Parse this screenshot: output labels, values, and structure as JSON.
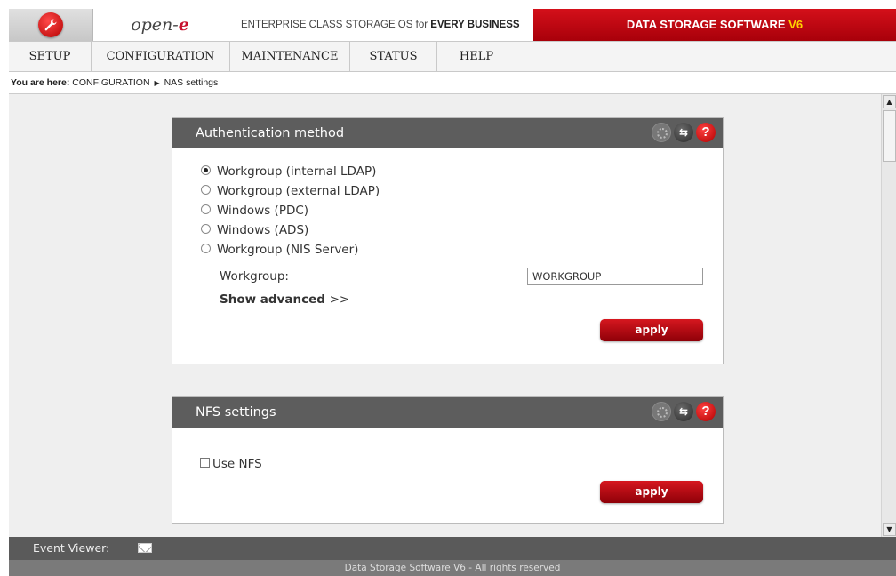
{
  "header": {
    "brand_prefix": "open-",
    "brand_suffix": "e",
    "tagline_plain": "ENTERPRISE CLASS STORAGE OS for ",
    "tagline_bold": "EVERY BUSINESS",
    "product_main": "DATA STORAGE SOFTWARE ",
    "product_version": "V6",
    "logo_icon": "wrench-icon"
  },
  "menu": {
    "items": [
      {
        "label": "SETUP"
      },
      {
        "label": "CONFIGURATION"
      },
      {
        "label": "MAINTENANCE"
      },
      {
        "label": "STATUS"
      },
      {
        "label": "HELP"
      }
    ]
  },
  "breadcrumb": {
    "prefix": "You are here:",
    "path": [
      "CONFIGURATION",
      "NAS settings"
    ]
  },
  "auth_panel": {
    "title": "Authentication method",
    "options": [
      {
        "label": "Workgroup (internal LDAP)",
        "selected": true
      },
      {
        "label": "Workgroup (external LDAP)",
        "selected": false
      },
      {
        "label": "Windows (PDC)",
        "selected": false
      },
      {
        "label": "Windows (ADS)",
        "selected": false
      },
      {
        "label": "Workgroup (NIS Server)",
        "selected": false
      }
    ],
    "workgroup_label": "Workgroup:",
    "workgroup_value": "WORKGROUP",
    "show_advanced": "Show advanced",
    "show_advanced_arrows": ">>",
    "apply_label": "apply"
  },
  "nfs_panel": {
    "title": "NFS settings",
    "use_nfs_label": "Use NFS",
    "use_nfs_checked": false,
    "apply_label": "apply"
  },
  "footer": {
    "event_viewer_label": "Event Viewer:",
    "copyright": "Data Storage Software V6 - All rights reserved"
  },
  "colors": {
    "accent_red": "#c8102e",
    "panel_header": "#5d5d5d",
    "version_yellow": "#ffd200"
  }
}
